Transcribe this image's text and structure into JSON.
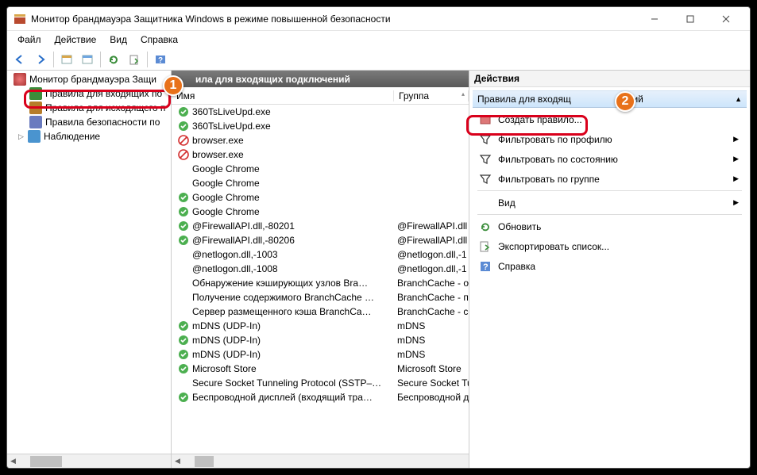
{
  "window": {
    "title": "Монитор брандмауэра Защитника Windows в режиме повышенной безопасности"
  },
  "menubar": {
    "items": [
      "Файл",
      "Действие",
      "Вид",
      "Справка"
    ]
  },
  "tree": {
    "root": "Монитор брандмауэра Защи",
    "items": [
      "Правила для входящих по",
      "Правила для исходящего п",
      "Правила безопасности по",
      "Наблюдение"
    ]
  },
  "main": {
    "title": "ила для входящих подключений",
    "columns": {
      "name": "Имя",
      "group": "Группа"
    }
  },
  "rules": [
    {
      "s": "ok",
      "name": "360TsLiveUpd.exe",
      "group": ""
    },
    {
      "s": "ok",
      "name": "360TsLiveUpd.exe",
      "group": ""
    },
    {
      "s": "block",
      "name": "browser.exe",
      "group": ""
    },
    {
      "s": "block",
      "name": "browser.exe",
      "group": ""
    },
    {
      "s": "none",
      "name": "Google Chrome",
      "group": ""
    },
    {
      "s": "none",
      "name": "Google Chrome",
      "group": ""
    },
    {
      "s": "ok",
      "name": "Google Chrome",
      "group": ""
    },
    {
      "s": "ok",
      "name": "Google Chrome",
      "group": ""
    },
    {
      "s": "ok",
      "name": "@FirewallAPI.dll,-80201",
      "group": "@FirewallAPI.dll"
    },
    {
      "s": "ok",
      "name": "@FirewallAPI.dll,-80206",
      "group": "@FirewallAPI.dll"
    },
    {
      "s": "none",
      "name": "@netlogon.dll,-1003",
      "group": "@netlogon.dll,-1"
    },
    {
      "s": "none",
      "name": "@netlogon.dll,-1008",
      "group": "@netlogon.dll,-1"
    },
    {
      "s": "none",
      "name": "Обнаружение кэширующих узлов Bra…",
      "group": "BranchCache - об"
    },
    {
      "s": "none",
      "name": "Получение содержимого BranchCache …",
      "group": "BranchCache - по"
    },
    {
      "s": "none",
      "name": "Сервер размещенного кэша BranchCa…",
      "group": "BranchCache - се"
    },
    {
      "s": "ok",
      "name": "mDNS (UDP-In)",
      "group": "mDNS"
    },
    {
      "s": "ok",
      "name": "mDNS (UDP-In)",
      "group": "mDNS"
    },
    {
      "s": "ok",
      "name": "mDNS (UDP-In)",
      "group": "mDNS"
    },
    {
      "s": "ok",
      "name": "Microsoft Store",
      "group": "Microsoft Store"
    },
    {
      "s": "none",
      "name": "Secure Socket Tunneling Protocol (SSTP–…",
      "group": "Secure Socket Tu"
    },
    {
      "s": "ok",
      "name": "Беспроводной дисплей (входящий тра…",
      "group": "Беспроводной д"
    }
  ],
  "actions": {
    "title": "Действия",
    "subtitle": "Правила для входящ",
    "subtitle_tail": "чений",
    "items": [
      {
        "icon": "new",
        "label": "Создать правило...",
        "arrow": false
      },
      {
        "icon": "filter",
        "label": "Фильтровать по профилю",
        "arrow": true
      },
      {
        "icon": "filter",
        "label": "Фильтровать по состоянию",
        "arrow": true
      },
      {
        "icon": "filter",
        "label": "Фильтровать по группе",
        "arrow": true
      },
      {
        "icon": "none",
        "label": "Вид",
        "arrow": true
      },
      {
        "icon": "refresh",
        "label": "Обновить",
        "arrow": false
      },
      {
        "icon": "export",
        "label": "Экспортировать список...",
        "arrow": false
      },
      {
        "icon": "help",
        "label": "Справка",
        "arrow": false
      }
    ]
  }
}
